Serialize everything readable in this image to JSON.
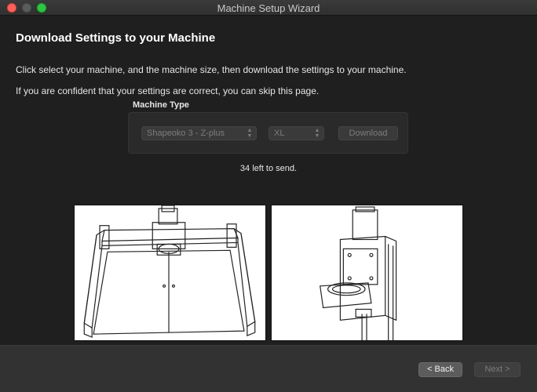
{
  "window": {
    "title": "Machine Setup Wizard"
  },
  "page": {
    "heading": "Download Settings to your Machine",
    "instruction1": "Click select your machine, and the machine size, then download the settings to your machine.",
    "instruction2": "If you are confident that your settings are correct, you can skip this page."
  },
  "machine_type": {
    "label": "Machine Type",
    "machine_select": "Shapeoko 3 - Z-plus",
    "size_select": "XL",
    "download_label": "Download"
  },
  "status": {
    "text": "34 left to send."
  },
  "footer": {
    "back_label": "< Back",
    "next_label": "Next >"
  },
  "colors": {
    "close": "#fe5f57",
    "minimize": "#5b5b5b",
    "maximize": "#28c840",
    "background": "#1f1f1f",
    "footer": "#323232"
  }
}
